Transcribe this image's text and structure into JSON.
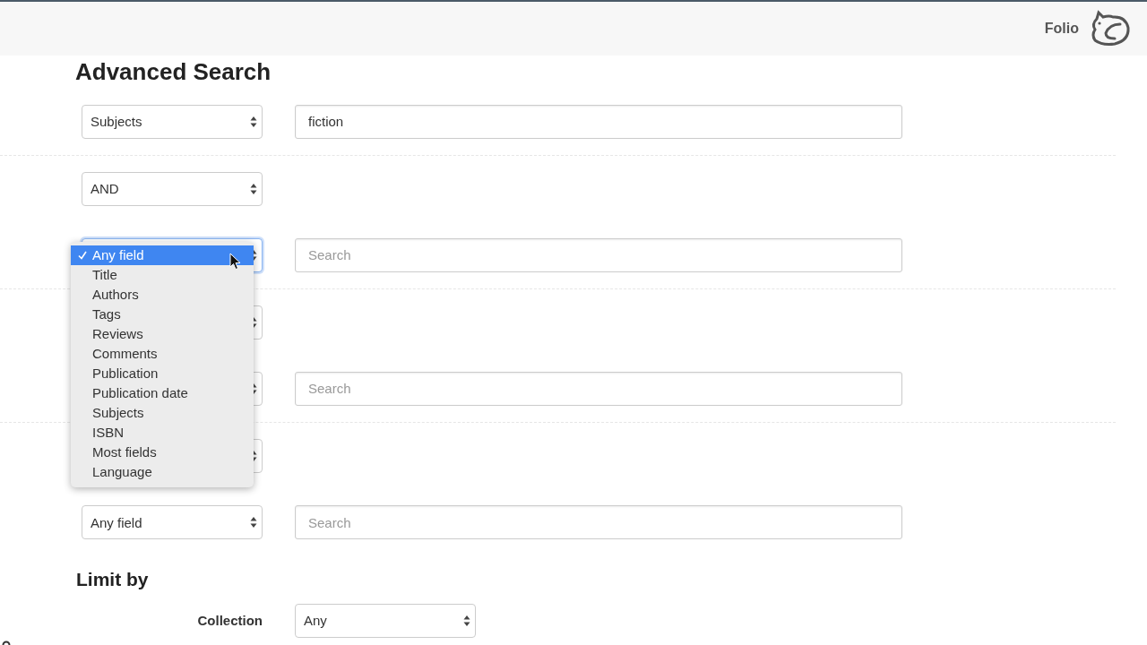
{
  "header": {
    "brand": "Folio"
  },
  "title": "Advanced Search",
  "rows": [
    {
      "kind": "term",
      "field": "Subjects",
      "query": {
        "value": "fiction"
      }
    },
    {
      "kind": "operator",
      "operator": "AND"
    },
    {
      "kind": "term",
      "query": {
        "placeholder": "Search"
      },
      "menu": {
        "items": [
          {
            "label": "Any field",
            "selected": true
          },
          {
            "label": "Title",
            "selected": false
          },
          {
            "label": "Authors",
            "selected": false
          },
          {
            "label": "Tags",
            "selected": false
          },
          {
            "label": "Reviews",
            "selected": false
          },
          {
            "label": "Comments",
            "selected": false
          },
          {
            "label": "Publication",
            "selected": false
          },
          {
            "label": "Publication date",
            "selected": false
          },
          {
            "label": "Subjects",
            "selected": false
          },
          {
            "label": "ISBN",
            "selected": false
          },
          {
            "label": "Most fields",
            "selected": false
          },
          {
            "label": "Language",
            "selected": false
          }
        ]
      }
    },
    {
      "kind": "operator"
    },
    {
      "kind": "term",
      "query": {
        "placeholder": "Search"
      }
    },
    {
      "kind": "operator"
    },
    {
      "kind": "term",
      "field": "Any field",
      "query": {
        "placeholder": "Search"
      }
    }
  ],
  "limit": {
    "heading": "Limit by",
    "filters": [
      {
        "label": "Collection",
        "value": "Any"
      }
    ]
  }
}
